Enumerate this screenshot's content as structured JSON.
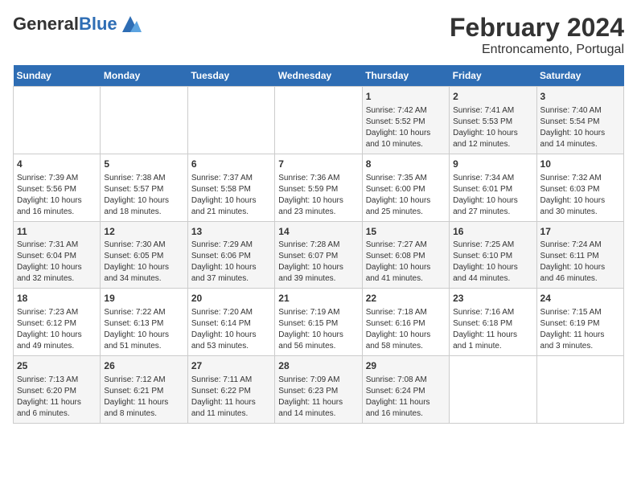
{
  "logo": {
    "general": "General",
    "blue": "Blue"
  },
  "title": "February 2024",
  "subtitle": "Entroncamento, Portugal",
  "days_of_week": [
    "Sunday",
    "Monday",
    "Tuesday",
    "Wednesday",
    "Thursday",
    "Friday",
    "Saturday"
  ],
  "weeks": [
    [
      {
        "day": "",
        "info": ""
      },
      {
        "day": "",
        "info": ""
      },
      {
        "day": "",
        "info": ""
      },
      {
        "day": "",
        "info": ""
      },
      {
        "day": "1",
        "info": "Sunrise: 7:42 AM\nSunset: 5:52 PM\nDaylight: 10 hours\nand 10 minutes."
      },
      {
        "day": "2",
        "info": "Sunrise: 7:41 AM\nSunset: 5:53 PM\nDaylight: 10 hours\nand 12 minutes."
      },
      {
        "day": "3",
        "info": "Sunrise: 7:40 AM\nSunset: 5:54 PM\nDaylight: 10 hours\nand 14 minutes."
      }
    ],
    [
      {
        "day": "4",
        "info": "Sunrise: 7:39 AM\nSunset: 5:56 PM\nDaylight: 10 hours\nand 16 minutes."
      },
      {
        "day": "5",
        "info": "Sunrise: 7:38 AM\nSunset: 5:57 PM\nDaylight: 10 hours\nand 18 minutes."
      },
      {
        "day": "6",
        "info": "Sunrise: 7:37 AM\nSunset: 5:58 PM\nDaylight: 10 hours\nand 21 minutes."
      },
      {
        "day": "7",
        "info": "Sunrise: 7:36 AM\nSunset: 5:59 PM\nDaylight: 10 hours\nand 23 minutes."
      },
      {
        "day": "8",
        "info": "Sunrise: 7:35 AM\nSunset: 6:00 PM\nDaylight: 10 hours\nand 25 minutes."
      },
      {
        "day": "9",
        "info": "Sunrise: 7:34 AM\nSunset: 6:01 PM\nDaylight: 10 hours\nand 27 minutes."
      },
      {
        "day": "10",
        "info": "Sunrise: 7:32 AM\nSunset: 6:03 PM\nDaylight: 10 hours\nand 30 minutes."
      }
    ],
    [
      {
        "day": "11",
        "info": "Sunrise: 7:31 AM\nSunset: 6:04 PM\nDaylight: 10 hours\nand 32 minutes."
      },
      {
        "day": "12",
        "info": "Sunrise: 7:30 AM\nSunset: 6:05 PM\nDaylight: 10 hours\nand 34 minutes."
      },
      {
        "day": "13",
        "info": "Sunrise: 7:29 AM\nSunset: 6:06 PM\nDaylight: 10 hours\nand 37 minutes."
      },
      {
        "day": "14",
        "info": "Sunrise: 7:28 AM\nSunset: 6:07 PM\nDaylight: 10 hours\nand 39 minutes."
      },
      {
        "day": "15",
        "info": "Sunrise: 7:27 AM\nSunset: 6:08 PM\nDaylight: 10 hours\nand 41 minutes."
      },
      {
        "day": "16",
        "info": "Sunrise: 7:25 AM\nSunset: 6:10 PM\nDaylight: 10 hours\nand 44 minutes."
      },
      {
        "day": "17",
        "info": "Sunrise: 7:24 AM\nSunset: 6:11 PM\nDaylight: 10 hours\nand 46 minutes."
      }
    ],
    [
      {
        "day": "18",
        "info": "Sunrise: 7:23 AM\nSunset: 6:12 PM\nDaylight: 10 hours\nand 49 minutes."
      },
      {
        "day": "19",
        "info": "Sunrise: 7:22 AM\nSunset: 6:13 PM\nDaylight: 10 hours\nand 51 minutes."
      },
      {
        "day": "20",
        "info": "Sunrise: 7:20 AM\nSunset: 6:14 PM\nDaylight: 10 hours\nand 53 minutes."
      },
      {
        "day": "21",
        "info": "Sunrise: 7:19 AM\nSunset: 6:15 PM\nDaylight: 10 hours\nand 56 minutes."
      },
      {
        "day": "22",
        "info": "Sunrise: 7:18 AM\nSunset: 6:16 PM\nDaylight: 10 hours\nand 58 minutes."
      },
      {
        "day": "23",
        "info": "Sunrise: 7:16 AM\nSunset: 6:18 PM\nDaylight: 11 hours\nand 1 minute."
      },
      {
        "day": "24",
        "info": "Sunrise: 7:15 AM\nSunset: 6:19 PM\nDaylight: 11 hours\nand 3 minutes."
      }
    ],
    [
      {
        "day": "25",
        "info": "Sunrise: 7:13 AM\nSunset: 6:20 PM\nDaylight: 11 hours\nand 6 minutes."
      },
      {
        "day": "26",
        "info": "Sunrise: 7:12 AM\nSunset: 6:21 PM\nDaylight: 11 hours\nand 8 minutes."
      },
      {
        "day": "27",
        "info": "Sunrise: 7:11 AM\nSunset: 6:22 PM\nDaylight: 11 hours\nand 11 minutes."
      },
      {
        "day": "28",
        "info": "Sunrise: 7:09 AM\nSunset: 6:23 PM\nDaylight: 11 hours\nand 14 minutes."
      },
      {
        "day": "29",
        "info": "Sunrise: 7:08 AM\nSunset: 6:24 PM\nDaylight: 11 hours\nand 16 minutes."
      },
      {
        "day": "",
        "info": ""
      },
      {
        "day": "",
        "info": ""
      }
    ]
  ]
}
